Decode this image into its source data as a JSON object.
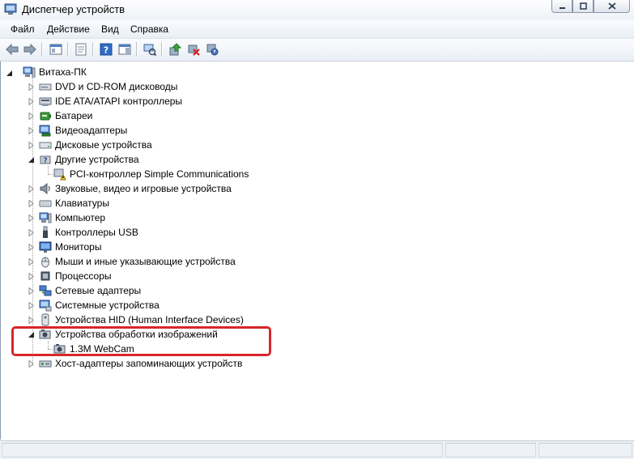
{
  "window": {
    "title": "Диспетчер устройств"
  },
  "menu": {
    "items": [
      "Файл",
      "Действие",
      "Вид",
      "Справка"
    ]
  },
  "tree": {
    "root": "Витаха-ПК",
    "categories": [
      {
        "label": "DVD и CD-ROM дисководы",
        "icon": "dvd-drive-icon"
      },
      {
        "label": "IDE ATA/ATAPI контроллеры",
        "icon": "ide-controller-icon"
      },
      {
        "label": "Батареи",
        "icon": "battery-icon"
      },
      {
        "label": "Видеоадаптеры",
        "icon": "display-adapter-icon"
      },
      {
        "label": "Дисковые устройства",
        "icon": "disk-drive-icon"
      },
      {
        "label": "Другие устройства",
        "icon": "other-devices-icon",
        "expanded": true,
        "children": [
          {
            "label": "PCI-контроллер Simple Communications",
            "icon": "warning-device-icon"
          }
        ]
      },
      {
        "label": "Звуковые, видео и игровые устройства",
        "icon": "sound-icon"
      },
      {
        "label": "Клавиатуры",
        "icon": "keyboard-icon"
      },
      {
        "label": "Компьютер",
        "icon": "computer-icon"
      },
      {
        "label": "Контроллеры USB",
        "icon": "usb-icon"
      },
      {
        "label": "Мониторы",
        "icon": "monitor-icon"
      },
      {
        "label": "Мыши и иные указывающие устройства",
        "icon": "mouse-icon"
      },
      {
        "label": "Процессоры",
        "icon": "processor-icon"
      },
      {
        "label": "Сетевые адаптеры",
        "icon": "network-adapter-icon"
      },
      {
        "label": "Системные устройства",
        "icon": "system-devices-icon"
      },
      {
        "label": "Устройства HID (Human Interface Devices)",
        "icon": "hid-icon"
      },
      {
        "label": "Устройства обработки изображений",
        "icon": "imaging-devices-icon",
        "expanded": true,
        "children": [
          {
            "label": "1.3M WebCam",
            "icon": "webcam-icon"
          }
        ]
      },
      {
        "label": "Хост-адаптеры запоминающих устройств",
        "icon": "storage-controller-icon"
      }
    ]
  },
  "colors": {
    "highlight": "#d8272b",
    "accent": "#1f6fd0"
  }
}
